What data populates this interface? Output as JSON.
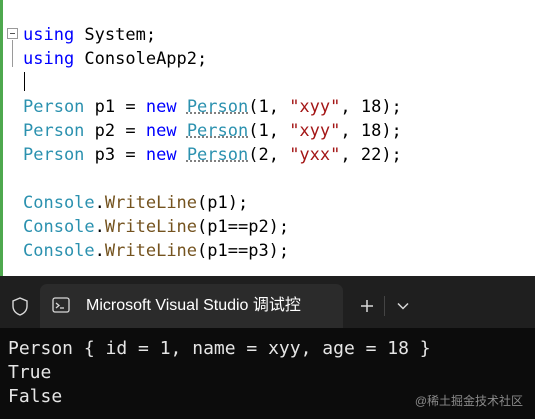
{
  "editor": {
    "lines": [
      {
        "id": "using-system",
        "tokens": [
          {
            "t": "using",
            "c": "kw"
          },
          {
            "t": " System;",
            "c": ""
          }
        ]
      },
      {
        "id": "using-consoleapp",
        "tokens": [
          {
            "t": "using",
            "c": "kw"
          },
          {
            "t": " ConsoleApp2;",
            "c": ""
          }
        ]
      },
      {
        "id": "blank-1",
        "tokens": []
      },
      {
        "id": "person-p1",
        "tokens": [
          {
            "t": "Person",
            "c": "ty"
          },
          {
            "t": " p1 = ",
            "c": ""
          },
          {
            "t": "new",
            "c": "kw"
          },
          {
            "t": " ",
            "c": ""
          },
          {
            "t": "Person",
            "c": "ty dot-hint"
          },
          {
            "t": "(1, ",
            "c": ""
          },
          {
            "t": "\"xyy\"",
            "c": "str"
          },
          {
            "t": ", 18);",
            "c": ""
          }
        ]
      },
      {
        "id": "person-p2",
        "tokens": [
          {
            "t": "Person",
            "c": "ty"
          },
          {
            "t": " p2 = ",
            "c": ""
          },
          {
            "t": "new",
            "c": "kw"
          },
          {
            "t": " ",
            "c": ""
          },
          {
            "t": "Person",
            "c": "ty dot-hint"
          },
          {
            "t": "(1, ",
            "c": ""
          },
          {
            "t": "\"xyy\"",
            "c": "str"
          },
          {
            "t": ", 18);",
            "c": ""
          }
        ]
      },
      {
        "id": "person-p3",
        "tokens": [
          {
            "t": "Person",
            "c": "ty"
          },
          {
            "t": " p3 = ",
            "c": ""
          },
          {
            "t": "new",
            "c": "kw"
          },
          {
            "t": " ",
            "c": ""
          },
          {
            "t": "Person",
            "c": "ty dot-hint"
          },
          {
            "t": "(2, ",
            "c": ""
          },
          {
            "t": "\"yxx\"",
            "c": "str"
          },
          {
            "t": ", 22);",
            "c": ""
          }
        ]
      },
      {
        "id": "blank-2",
        "tokens": []
      },
      {
        "id": "writeline-p1",
        "tokens": [
          {
            "t": "Console",
            "c": "ty"
          },
          {
            "t": ".",
            "c": ""
          },
          {
            "t": "WriteLine",
            "c": "mth"
          },
          {
            "t": "(p1);",
            "c": ""
          }
        ]
      },
      {
        "id": "writeline-p1-eq-p2",
        "tokens": [
          {
            "t": "Console",
            "c": "ty"
          },
          {
            "t": ".",
            "c": ""
          },
          {
            "t": "WriteLine",
            "c": "mth"
          },
          {
            "t": "(p1==p2);",
            "c": ""
          }
        ]
      },
      {
        "id": "writeline-p1-eq-p3",
        "tokens": [
          {
            "t": "Console",
            "c": "ty"
          },
          {
            "t": ".",
            "c": ""
          },
          {
            "t": "WriteLine",
            "c": "mth"
          },
          {
            "t": "(p1==p3);",
            "c": ""
          }
        ]
      }
    ]
  },
  "terminal": {
    "tab_title": "Microsoft Visual Studio 调试控",
    "tab_icon": "console-window-icon",
    "shield_icon": "shield-icon",
    "new_tab_icon": "plus-icon",
    "dropdown_icon": "chevron-down-icon",
    "output": [
      "Person { id = 1, name = xyy, age = 18 }",
      "True",
      "False"
    ],
    "watermark": "@稀土掘金技术社区"
  },
  "colors": {
    "keyword": "#0000ff",
    "type": "#2b91af",
    "string": "#a31515",
    "method": "#74531f",
    "terminal_bg": "#0c0c0c",
    "tabbar_bg": "#1f1f1f",
    "tab_bg": "#2b2b2b",
    "change_bar": "#4ea84e"
  }
}
